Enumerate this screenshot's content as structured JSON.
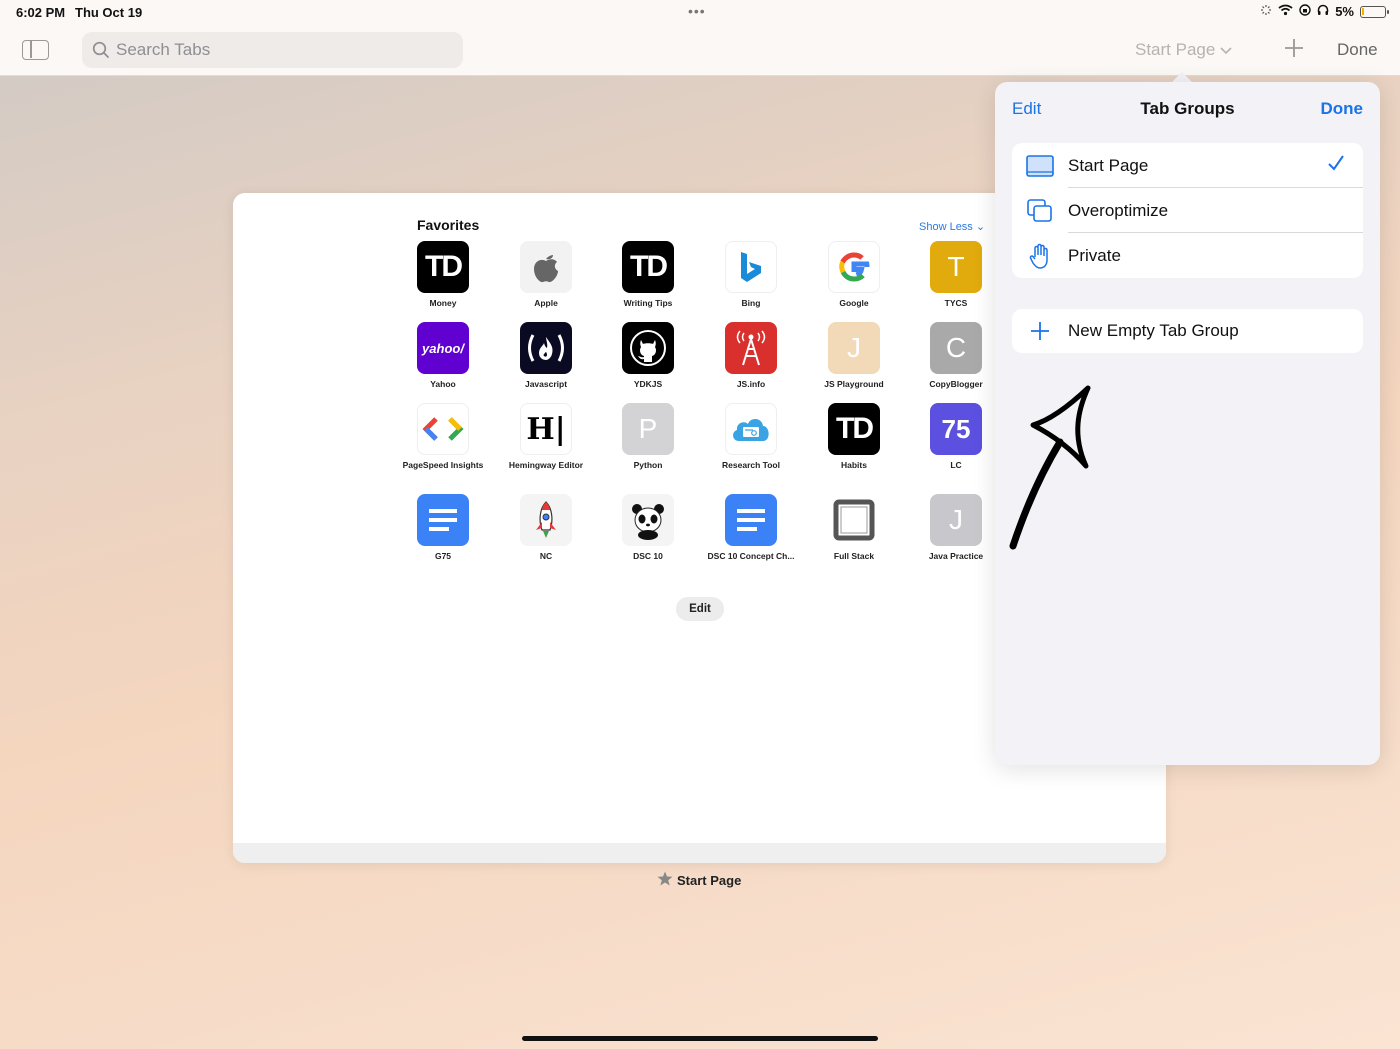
{
  "status": {
    "time": "6:02 PM",
    "date": "Thu Oct 19",
    "battery": "5%"
  },
  "toolbar": {
    "search_placeholder": "Search Tabs",
    "group_label": "Start Page",
    "done_label": "Done"
  },
  "start_page": {
    "favorites_title": "Favorites",
    "show_less_label": "Show Less",
    "edit_label": "Edit",
    "favorites": [
      {
        "label": "Money",
        "tile_text": "TD"
      },
      {
        "label": "Apple",
        "tile_text": ""
      },
      {
        "label": "Writing Tips",
        "tile_text": "TD"
      },
      {
        "label": "Bing",
        "tile_text": ""
      },
      {
        "label": "Google",
        "tile_text": "G"
      },
      {
        "label": "TYCS",
        "tile_text": "T"
      },
      {
        "label": "Yahoo",
        "tile_text": "yahoo/"
      },
      {
        "label": "Javascript",
        "tile_text": ""
      },
      {
        "label": "YDKJS",
        "tile_text": ""
      },
      {
        "label": "JS.info",
        "tile_text": ""
      },
      {
        "label": "JS Playground",
        "tile_text": "J"
      },
      {
        "label": "CopyBlogger",
        "tile_text": "C"
      },
      {
        "label": "PageSpeed Insights",
        "tile_text": ""
      },
      {
        "label": "Hemingway Editor",
        "tile_text": "H|"
      },
      {
        "label": "Python",
        "tile_text": "P"
      },
      {
        "label": "Research Tool",
        "tile_text": ""
      },
      {
        "label": "Habits",
        "tile_text": "TD"
      },
      {
        "label": "LC",
        "tile_text": "75"
      },
      {
        "label": "G75",
        "tile_text": ""
      },
      {
        "label": "NC",
        "tile_text": ""
      },
      {
        "label": "DSC 10",
        "tile_text": ""
      },
      {
        "label": "DSC 10 Concept Ch...",
        "tile_text": ""
      },
      {
        "label": "Full Stack",
        "tile_text": ""
      },
      {
        "label": "Java Practice",
        "tile_text": "J"
      }
    ],
    "tab_caption": "Start Page"
  },
  "tab_groups_popover": {
    "edit_label": "Edit",
    "title": "Tab Groups",
    "done_label": "Done",
    "groups": [
      {
        "label": "Start Page",
        "selected": true,
        "icon": "tablet-icon"
      },
      {
        "label": "Overoptimize",
        "selected": false,
        "icon": "tabs-icon"
      },
      {
        "label": "Private",
        "selected": false,
        "icon": "hand-icon"
      }
    ],
    "new_group_label": "New Empty Tab Group"
  },
  "colors": {
    "accent": "#1a73e8"
  }
}
